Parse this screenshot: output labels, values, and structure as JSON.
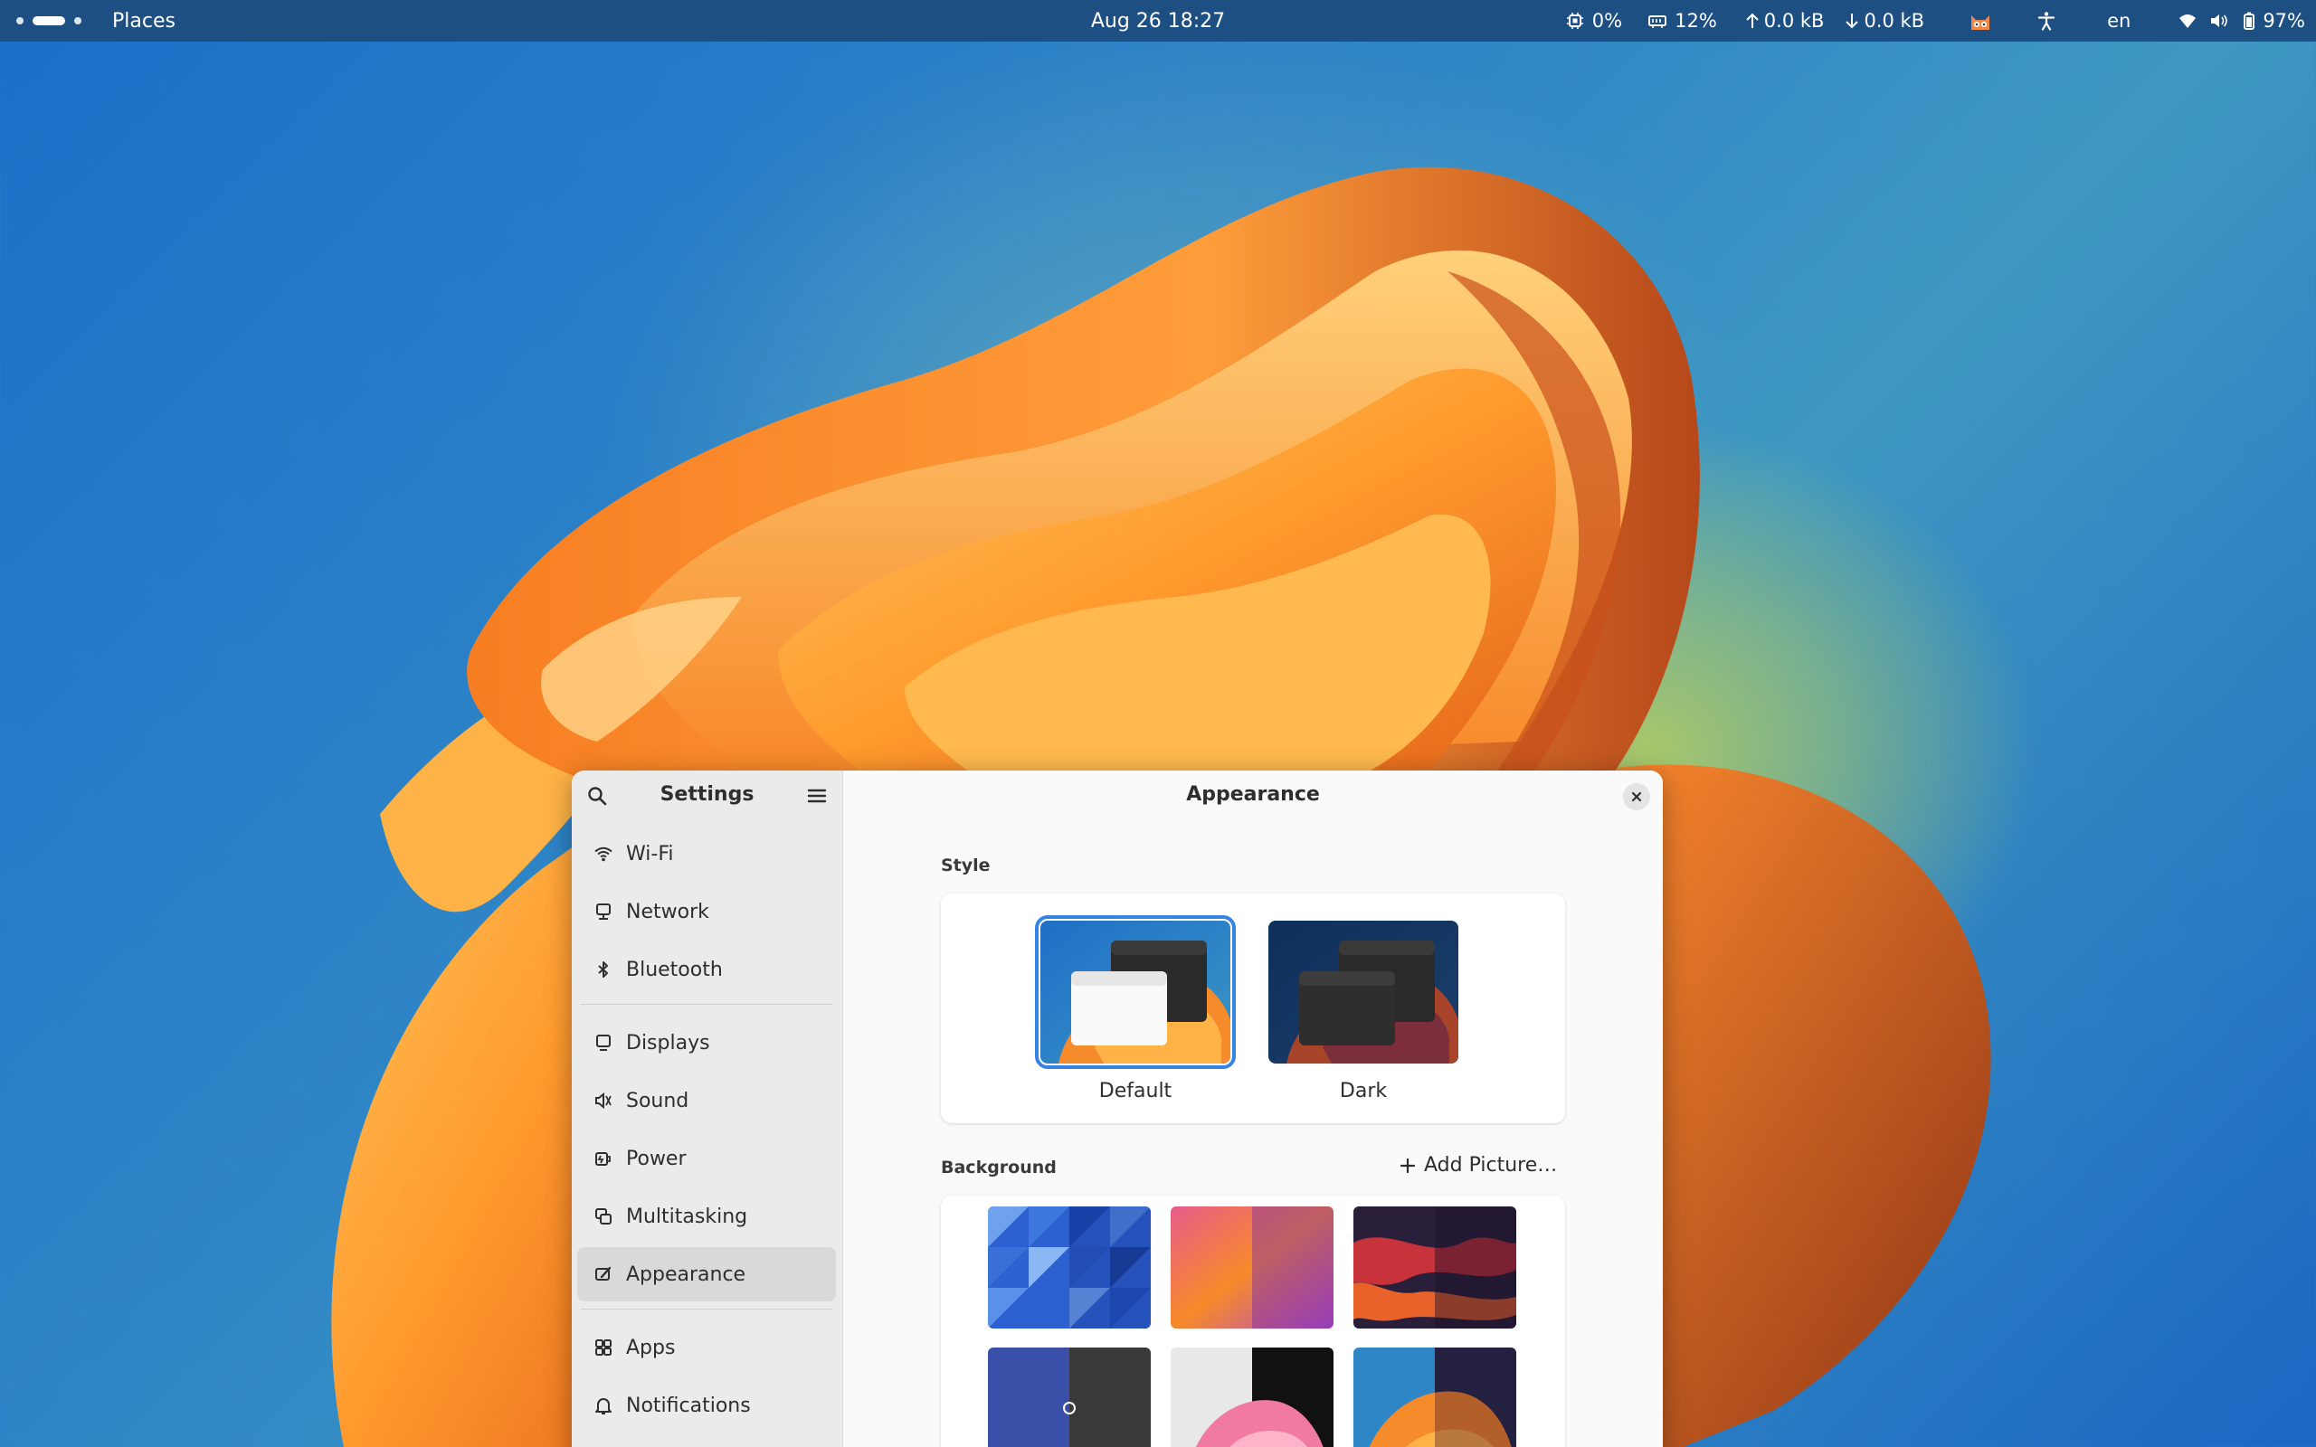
{
  "topbar": {
    "places_label": "Places",
    "datetime": "Aug 26  18:27",
    "cpu": "0%",
    "memory": "12%",
    "upload": "0.0 kB",
    "download": "0.0 kB",
    "language": "en",
    "battery": "97%",
    "icons": [
      "cpu-icon",
      "memory-icon",
      "upload-arrow-icon",
      "download-arrow-icon",
      "cat-face-icon",
      "accessibility-icon",
      "wifi-icon",
      "volume-icon",
      "battery-icon"
    ]
  },
  "sidebar": {
    "title": "Settings",
    "items": [
      {
        "label": "Wi-Fi",
        "icon": "wifi-icon"
      },
      {
        "label": "Network",
        "icon": "network-icon"
      },
      {
        "label": "Bluetooth",
        "icon": "bluetooth-icon"
      },
      {
        "label": "Displays",
        "icon": "display-icon"
      },
      {
        "label": "Sound",
        "icon": "sound-icon"
      },
      {
        "label": "Power",
        "icon": "power-icon"
      },
      {
        "label": "Multitasking",
        "icon": "multitasking-icon"
      },
      {
        "label": "Appearance",
        "icon": "appearance-icon",
        "active": true
      },
      {
        "label": "Apps",
        "icon": "apps-icon"
      },
      {
        "label": "Notifications",
        "icon": "bell-icon"
      }
    ]
  },
  "main": {
    "title": "Appearance",
    "style_label": "Style",
    "styles": [
      {
        "label": "Default",
        "selected": true
      },
      {
        "label": "Dark",
        "selected": false
      }
    ],
    "background_label": "Background",
    "add_picture_label": "Add Picture…"
  },
  "colors": {
    "accent": "#3584e4",
    "topbar": "#1e4f82",
    "sidebar_bg": "#ebebeb",
    "content_bg": "#fafafa"
  }
}
